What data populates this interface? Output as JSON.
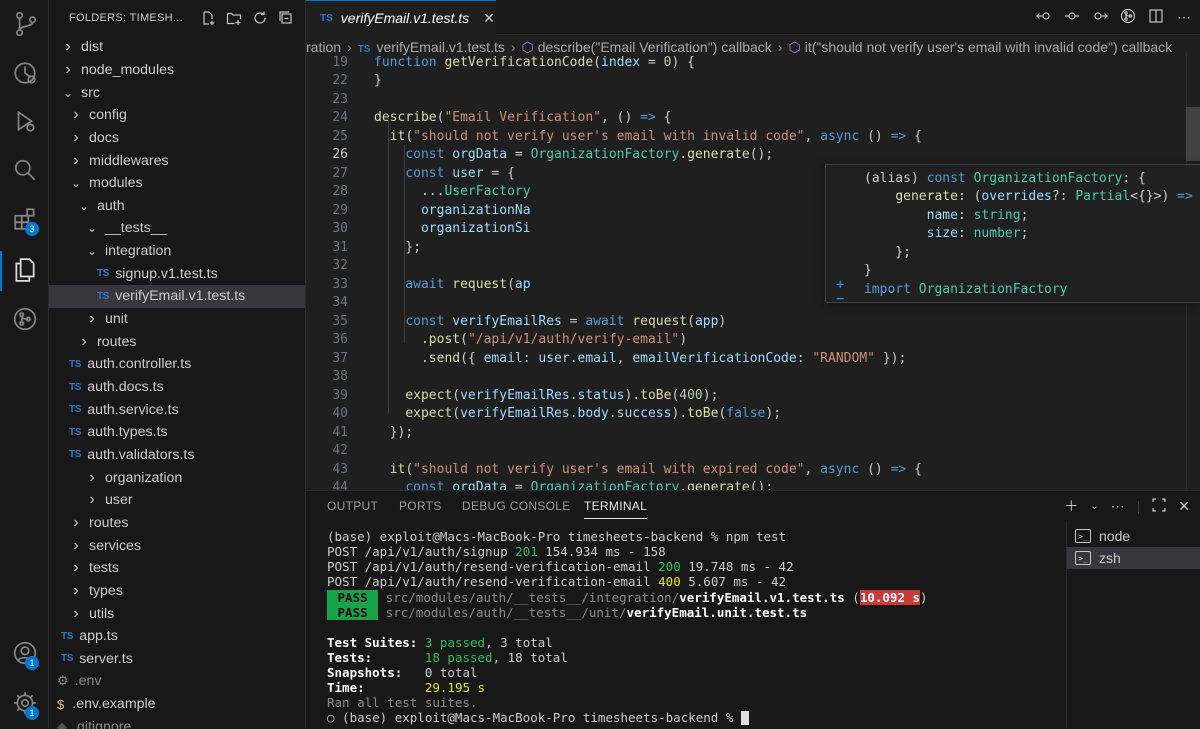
{
  "activity_bar": {
    "items": [
      {
        "icon": "source-control-icon"
      },
      {
        "icon": "timeline-icon"
      },
      {
        "icon": "run-debug-icon"
      },
      {
        "icon": "search-icon"
      },
      {
        "icon": "extensions-icon",
        "badge": "3"
      },
      {
        "icon": "explorer-icon"
      },
      {
        "icon": "git-graph-icon"
      }
    ],
    "bottom": [
      {
        "icon": "account-icon",
        "badge": "1"
      },
      {
        "icon": "settings-gear-icon",
        "badge": "1"
      }
    ]
  },
  "explorer": {
    "title": "FOLDERS: TIMESH...",
    "items": [
      {
        "label": "dist",
        "kind": "folder",
        "open": false
      },
      {
        "label": "node_modules",
        "kind": "folder",
        "open": false
      },
      {
        "label": "src",
        "kind": "folder",
        "open": true
      },
      {
        "label": "config",
        "kind": "folder",
        "open": false
      },
      {
        "label": "docs",
        "kind": "folder",
        "open": false
      },
      {
        "label": "middlewares",
        "kind": "folder",
        "open": false
      },
      {
        "label": "modules",
        "kind": "folder",
        "open": true
      },
      {
        "label": "auth",
        "kind": "folder",
        "open": true
      },
      {
        "label": "__tests__",
        "kind": "folder",
        "open": true
      },
      {
        "label": "integration",
        "kind": "folder",
        "open": true
      },
      {
        "label": "signup.v1.test.ts",
        "kind": "ts"
      },
      {
        "label": "verifyEmail.v1.test.ts",
        "kind": "ts",
        "selected": true
      },
      {
        "label": "unit",
        "kind": "folder",
        "open": false
      },
      {
        "label": "routes",
        "kind": "folder",
        "open": false
      },
      {
        "label": "auth.controller.ts",
        "kind": "ts"
      },
      {
        "label": "auth.docs.ts",
        "kind": "ts"
      },
      {
        "label": "auth.service.ts",
        "kind": "ts"
      },
      {
        "label": "auth.types.ts",
        "kind": "ts"
      },
      {
        "label": "auth.validators.ts",
        "kind": "ts"
      },
      {
        "label": "organization",
        "kind": "folder",
        "open": false
      },
      {
        "label": "user",
        "kind": "folder",
        "open": false
      },
      {
        "label": "routes",
        "kind": "folder",
        "open": false
      },
      {
        "label": "services",
        "kind": "folder",
        "open": false
      },
      {
        "label": "tests",
        "kind": "folder",
        "open": false
      },
      {
        "label": "types",
        "kind": "folder",
        "open": false
      },
      {
        "label": "utils",
        "kind": "folder",
        "open": false
      },
      {
        "label": "app.ts",
        "kind": "ts"
      },
      {
        "label": "server.ts",
        "kind": "ts"
      },
      {
        "label": ".env",
        "kind": "env"
      },
      {
        "label": ".env.example",
        "kind": "dollar"
      },
      {
        "label": ".gitignore",
        "kind": "git"
      }
    ]
  },
  "editor": {
    "tab": {
      "icon_text": "TS",
      "label": "verifyEmail.v1.test.ts",
      "close": "✕"
    },
    "breadcrumb": [
      {
        "text": "ration",
        "kind": "plain"
      },
      {
        "text": "verifyEmail.v1.test.ts",
        "kind": "ts"
      },
      {
        "text": "describe(\"Email Verification\") callback",
        "kind": "symbol"
      },
      {
        "text": "it(\"should not verify user's email with invalid code\") callback",
        "kind": "symbol"
      }
    ],
    "lines": [
      {
        "n": "19",
        "tokens": [
          [
            "k",
            "function "
          ],
          [
            "f",
            "getVerificationCode"
          ],
          [
            "p",
            "("
          ],
          [
            "v",
            "index"
          ],
          [
            "p",
            " = "
          ],
          [
            "n",
            "0"
          ],
          [
            "p",
            ") {"
          ]
        ]
      },
      {
        "n": "22",
        "tokens": [
          [
            "p",
            "}"
          ]
        ]
      },
      {
        "n": "23",
        "tokens": []
      },
      {
        "n": "24",
        "tokens": [
          [
            "f",
            "describe"
          ],
          [
            "p",
            "("
          ],
          [
            "s",
            "\"Email Verification\""
          ],
          [
            "p",
            ", () "
          ],
          [
            "k",
            "=>"
          ],
          [
            "p",
            " {"
          ]
        ]
      },
      {
        "n": "25",
        "tokens": [
          [
            "p",
            "  "
          ],
          [
            "f",
            "it"
          ],
          [
            "p",
            "("
          ],
          [
            "s",
            "\"should not verify user's email with invalid code\""
          ],
          [
            "p",
            ", "
          ],
          [
            "k",
            "async"
          ],
          [
            "p",
            " () "
          ],
          [
            "k",
            "=>"
          ],
          [
            "p",
            " {"
          ]
        ]
      },
      {
        "n": "26",
        "tokens": [
          [
            "p",
            "    "
          ],
          [
            "k",
            "const "
          ],
          [
            "v",
            "orgData"
          ],
          [
            "p",
            " = "
          ],
          [
            "c",
            "OrganizationFactory"
          ],
          [
            "p",
            "."
          ],
          [
            "f",
            "generate"
          ],
          [
            "p",
            "();"
          ]
        ],
        "current": true
      },
      {
        "n": "27",
        "tokens": [
          [
            "p",
            "    "
          ],
          [
            "k",
            "const "
          ],
          [
            "v",
            "user"
          ],
          [
            "p",
            " = {"
          ]
        ]
      },
      {
        "n": "28",
        "tokens": [
          [
            "p",
            "      ..."
          ],
          [
            "c",
            "UserFactory"
          ]
        ]
      },
      {
        "n": "29",
        "tokens": [
          [
            "p",
            "      "
          ],
          [
            "v",
            "organizationNa"
          ]
        ]
      },
      {
        "n": "30",
        "tokens": [
          [
            "p",
            "      "
          ],
          [
            "v",
            "organizationSi"
          ]
        ]
      },
      {
        "n": "31",
        "tokens": [
          [
            "p",
            "    };"
          ]
        ]
      },
      {
        "n": "32",
        "tokens": []
      },
      {
        "n": "33",
        "tokens": [
          [
            "p",
            "    "
          ],
          [
            "k",
            "await "
          ],
          [
            "f",
            "request"
          ],
          [
            "p",
            "("
          ],
          [
            "v",
            "ap"
          ]
        ]
      },
      {
        "n": "34",
        "tokens": []
      },
      {
        "n": "35",
        "tokens": [
          [
            "p",
            "    "
          ],
          [
            "k",
            "const "
          ],
          [
            "v",
            "verifyEmailRes"
          ],
          [
            "p",
            " = "
          ],
          [
            "k",
            "await "
          ],
          [
            "f",
            "request"
          ],
          [
            "p",
            "("
          ],
          [
            "v",
            "app"
          ],
          [
            "p",
            ")"
          ]
        ]
      },
      {
        "n": "36",
        "tokens": [
          [
            "p",
            "      ."
          ],
          [
            "f",
            "post"
          ],
          [
            "p",
            "("
          ],
          [
            "s",
            "\"/api/v1/auth/verify-email\""
          ],
          [
            "p",
            ")"
          ]
        ]
      },
      {
        "n": "37",
        "tokens": [
          [
            "p",
            "      ."
          ],
          [
            "f",
            "send"
          ],
          [
            "p",
            "({ "
          ],
          [
            "v",
            "email"
          ],
          [
            "p",
            ": "
          ],
          [
            "v",
            "user"
          ],
          [
            "p",
            "."
          ],
          [
            "v",
            "email"
          ],
          [
            "p",
            ", "
          ],
          [
            "v",
            "emailVerificationCode"
          ],
          [
            "p",
            ": "
          ],
          [
            "s",
            "\"RANDOM\""
          ],
          [
            "p",
            " });"
          ]
        ]
      },
      {
        "n": "38",
        "tokens": []
      },
      {
        "n": "39",
        "tokens": [
          [
            "p",
            "    "
          ],
          [
            "f",
            "expect"
          ],
          [
            "p",
            "("
          ],
          [
            "v",
            "verifyEmailRes"
          ],
          [
            "p",
            "."
          ],
          [
            "v",
            "status"
          ],
          [
            "p",
            ")."
          ],
          [
            "f",
            "toBe"
          ],
          [
            "p",
            "("
          ],
          [
            "n",
            "400"
          ],
          [
            "p",
            ");"
          ]
        ]
      },
      {
        "n": "40",
        "tokens": [
          [
            "p",
            "    "
          ],
          [
            "f",
            "expect"
          ],
          [
            "p",
            "("
          ],
          [
            "v",
            "verifyEmailRes"
          ],
          [
            "p",
            "."
          ],
          [
            "v",
            "body"
          ],
          [
            "p",
            "."
          ],
          [
            "v",
            "success"
          ],
          [
            "p",
            ")."
          ],
          [
            "f",
            "toBe"
          ],
          [
            "p",
            "("
          ],
          [
            "k",
            "false"
          ],
          [
            "p",
            ");"
          ]
        ]
      },
      {
        "n": "41",
        "tokens": [
          [
            "p",
            "  });"
          ]
        ]
      },
      {
        "n": "42",
        "tokens": []
      },
      {
        "n": "43",
        "tokens": [
          [
            "p",
            "  "
          ],
          [
            "f",
            "it"
          ],
          [
            "p",
            "("
          ],
          [
            "s",
            "\"should not verify user's email with expired code\""
          ],
          [
            "p",
            ", "
          ],
          [
            "k",
            "async"
          ],
          [
            "p",
            " () "
          ],
          [
            "k",
            "=>"
          ],
          [
            "p",
            " {"
          ]
        ]
      },
      {
        "n": "44",
        "tokens": [
          [
            "p",
            "    "
          ],
          [
            "k",
            "const "
          ],
          [
            "v",
            "orgData"
          ],
          [
            "p",
            " = "
          ],
          [
            "c",
            "OrganizationFactory"
          ],
          [
            "p",
            "."
          ],
          [
            "f",
            "generate"
          ],
          [
            "p",
            "();"
          ]
        ]
      }
    ],
    "hover": {
      "lines": [
        [
          [
            "p",
            "(alias) "
          ],
          [
            "k",
            "const "
          ],
          [
            "c",
            "OrganizationFactory"
          ],
          [
            "p",
            ": {"
          ]
        ],
        [
          [
            "p",
            "    "
          ],
          [
            "f",
            "generate"
          ],
          [
            "p",
            ": ("
          ],
          [
            "v",
            "overrides"
          ],
          [
            "p",
            "?: "
          ],
          [
            "c",
            "Partial"
          ],
          [
            "p",
            "<{}>) "
          ],
          [
            "k",
            "=>"
          ],
          [
            "p",
            " {"
          ]
        ],
        [
          [
            "p",
            "        "
          ],
          [
            "v",
            "name"
          ],
          [
            "p",
            ": "
          ],
          [
            "c",
            "string"
          ],
          [
            "p",
            ";"
          ]
        ],
        [
          [
            "p",
            "        "
          ],
          [
            "v",
            "size"
          ],
          [
            "p",
            ": "
          ],
          [
            "c",
            "number"
          ],
          [
            "p",
            ";"
          ]
        ],
        [
          [
            "p",
            "    };"
          ]
        ],
        [
          [
            "p",
            "}"
          ]
        ],
        [
          [
            "k",
            "import "
          ],
          [
            "c",
            "OrganizationFactory"
          ]
        ]
      ],
      "plus": "+",
      "minus": "−"
    }
  },
  "panel": {
    "tabs": [
      {
        "label": "OUTPUT",
        "active": false
      },
      {
        "label": "PORTS",
        "active": false
      },
      {
        "label": "DEBUG CONSOLE",
        "active": false
      },
      {
        "label": "TERMINAL",
        "active": true
      }
    ],
    "terminal_lines": [
      [
        [
          "p",
          "(base) exploit@Macs-MacBook-Pro timesheets-backend % npm test"
        ]
      ],
      [
        [
          "p",
          "POST /api/v1/auth/signup "
        ],
        [
          "g",
          "201"
        ],
        [
          "p",
          " 154.934 ms - 158"
        ]
      ],
      [
        [
          "p",
          "POST /api/v1/auth/resend-verification-email "
        ],
        [
          "g",
          "200"
        ],
        [
          "p",
          " 19.748 ms - 42"
        ]
      ],
      [
        [
          "p",
          "POST /api/v1/auth/resend-verification-email "
        ],
        [
          "y",
          "400"
        ],
        [
          "p",
          " 5.607 ms - 42"
        ]
      ],
      [
        [
          "pass",
          " PASS "
        ],
        [
          "p",
          " "
        ],
        [
          "dimt",
          "src/modules/auth/__tests__/integration/"
        ],
        [
          "b",
          "verifyEmail.v1.test.ts"
        ],
        [
          "p",
          " ("
        ],
        [
          "red",
          "10.092 s"
        ],
        [
          "p",
          ")"
        ]
      ],
      [
        [
          "pass",
          " PASS "
        ],
        [
          "p",
          " "
        ],
        [
          "dimt",
          "src/modules/auth/__tests__/unit/"
        ],
        [
          "b",
          "verifyEmail.unit.test.ts"
        ]
      ],
      [],
      [
        [
          "b",
          "Test Suites: "
        ],
        [
          "g",
          "3 passed"
        ],
        [
          "p",
          ", 3 total"
        ]
      ],
      [
        [
          "b",
          "Tests:       "
        ],
        [
          "g",
          "18 passed"
        ],
        [
          "p",
          ", 18 total"
        ]
      ],
      [
        [
          "b",
          "Snapshots:   "
        ],
        [
          "p",
          "0 total"
        ]
      ],
      [
        [
          "b",
          "Time:        "
        ],
        [
          "y",
          "29.195 s"
        ]
      ],
      [
        [
          "dimt",
          "Ran all test suites."
        ]
      ],
      [
        [
          "p",
          "○ (base) exploit@Macs-MacBook-Pro timesheets-backend % "
        ],
        [
          "cursor",
          ""
        ]
      ]
    ],
    "terminals": [
      {
        "label": "node",
        "active": false
      },
      {
        "label": "zsh",
        "active": true
      }
    ]
  }
}
